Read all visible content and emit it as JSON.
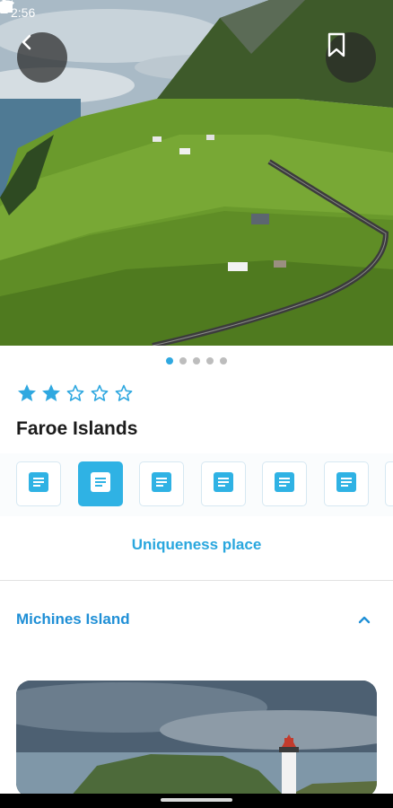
{
  "status_bar": {
    "time": "2:56"
  },
  "hero": {
    "image_alt": "Faroe Islands landscape",
    "carousel_total": 5,
    "carousel_active_index": 0
  },
  "place": {
    "rating": 2,
    "rating_max": 5,
    "name": "Faroe Islands"
  },
  "tabs": {
    "count": 7,
    "active_index": 1,
    "icon": "document-icon"
  },
  "uniqueness_label": "Uniqueness place",
  "section": {
    "title": "Michines Island",
    "expanded": true
  },
  "colors": {
    "accent": "#2FB2E4",
    "section_title": "#1F8FD6",
    "star": "#2FA8E0"
  }
}
